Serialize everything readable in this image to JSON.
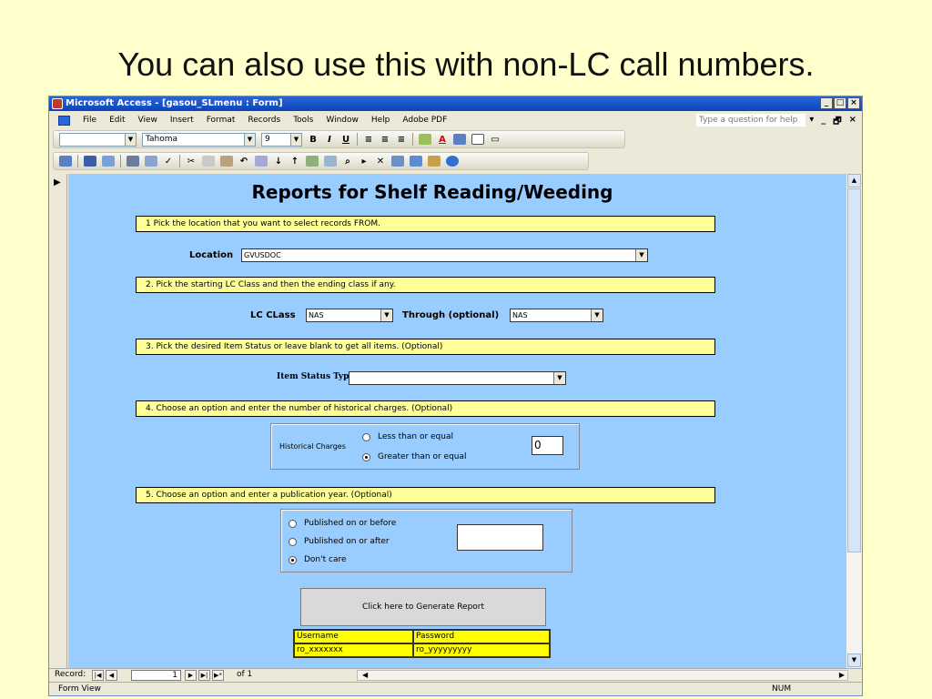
{
  "slide": {
    "title": "You can also use this with non-LC call numbers."
  },
  "window": {
    "title": "Microsoft Access - [gasou_SLmenu : Form]",
    "controls": [
      "_",
      "□",
      "×"
    ]
  },
  "menubar": {
    "items": [
      "File",
      "Edit",
      "View",
      "Insert",
      "Format",
      "Records",
      "Tools",
      "Window",
      "Help",
      "Adobe PDF"
    ],
    "help_placeholder": "Type a question for help",
    "doc_controls": [
      "▾",
      "_",
      "🗗",
      "×"
    ]
  },
  "toolbar": {
    "object_combo": "",
    "font": "Tahoma",
    "font_size": "9",
    "bold": "B",
    "italic": "I",
    "underline": "U"
  },
  "form": {
    "title": "Reports for Shelf Reading/Weeding",
    "steps": [
      "1  Pick the location that you want to select records FROM.",
      "2.  Pick the starting LC Class and then the ending class if any.",
      "3.  Pick the desired Item Status or leave blank to get all items. (Optional)",
      "4.  Choose an option and enter the number of historical charges. (Optional)",
      "5.  Choose an option and enter a publication year. (Optional)"
    ],
    "location": {
      "label": "Location",
      "value": "GVUSDOC"
    },
    "lc_class": {
      "label": "LC CLass",
      "value": "NAS"
    },
    "through": {
      "label": "Through (optional)",
      "value": "NAS"
    },
    "item_status": {
      "label": "Item Status Type",
      "value": ""
    },
    "historical": {
      "label": "Historical Charges",
      "options": [
        "Less than or equal",
        "Greater than or equal"
      ],
      "selected": 1,
      "value": "0"
    },
    "publication": {
      "options": [
        "Published on or before",
        "Published on or after",
        "Don't care"
      ],
      "selected": 2,
      "value": ""
    },
    "generate_button": "Click here to Generate  Report",
    "credentials": {
      "headers": [
        "Username",
        "Password"
      ],
      "values": [
        "ro_xxxxxxx",
        "ro_yyyyyyyyy"
      ]
    }
  },
  "navigation": {
    "label": "Record:",
    "current": "1",
    "of_text": "of  1"
  },
  "status": {
    "left": "Form View",
    "right": "NUM"
  }
}
